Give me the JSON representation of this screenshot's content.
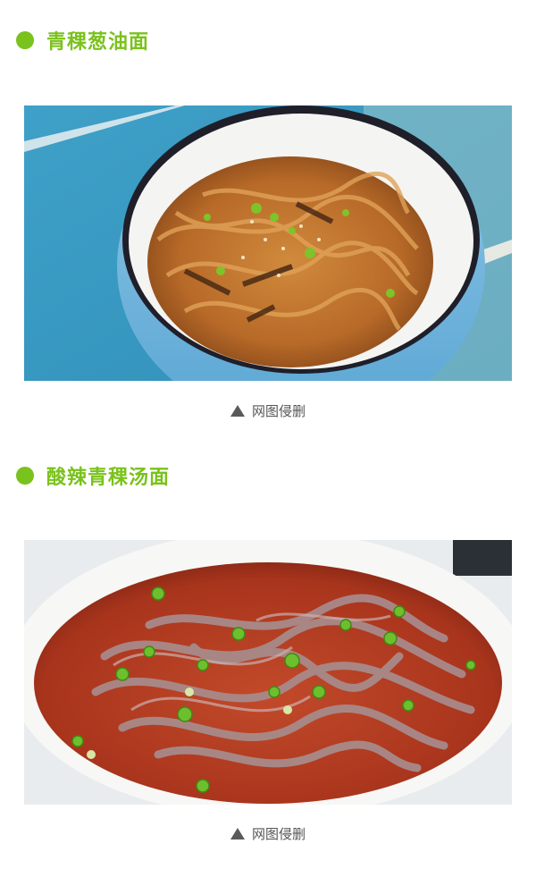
{
  "sections": [
    {
      "title": "青稞葱油面",
      "caption": "网图侵删",
      "photo_subject": "noodles-with-scallion-oil-in-white-bowl"
    },
    {
      "title": "酸辣青稞汤面",
      "caption": "网图侵删",
      "photo_subject": "hot-and-sour-noodle-soup-in-white-bowl"
    }
  ],
  "colors": {
    "accent_green": "#7ac21c",
    "caption_gray": "#555555"
  },
  "icons": {
    "bullet": "green-dot-icon",
    "caption_marker": "up-triangle-icon"
  }
}
